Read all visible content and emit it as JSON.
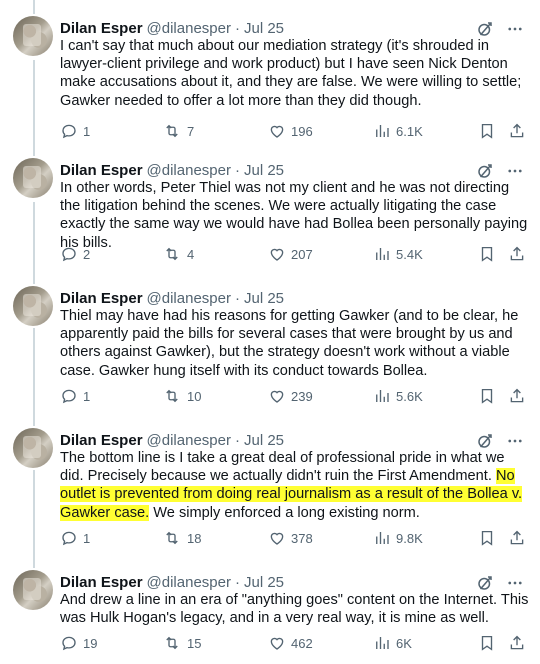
{
  "author": {
    "name": "Dilan Esper",
    "handle": "@dilanesper",
    "separator": "·"
  },
  "colors": {
    "text": "#0f1419",
    "secondary": "#536471",
    "highlight": "#ffff33",
    "thread_line": "#cfd9de"
  },
  "tweets": [
    {
      "date": "Jul 25",
      "text": "I can't say that much about our mediation strategy (it's shrouded in lawyer-client privilege and work product) but I have seen Nick Denton make accusations about it, and they are false. We were willing to settle; Gawker needed to offer a lot more than they did though.",
      "replies": "1",
      "retweets": "7",
      "likes": "196",
      "views": "6.1K"
    },
    {
      "date": "Jul 25",
      "text": "In other words, Peter Thiel was not my client and he was not directing the litigation behind the scenes. We were actually litigating the case exactly the same way we would have had Bollea been personally paying his bills.",
      "replies": "2",
      "retweets": "4",
      "likes": "207",
      "views": "5.4K"
    },
    {
      "date": "Jul 25",
      "text": "Thiel may have had his reasons for getting Gawker (and to be clear, he apparently paid the bills for several cases that were brought by us and others against Gawker), but the strategy doesn't work without a viable case. Gawker hung itself with its conduct towards Bollea.",
      "replies": "1",
      "retweets": "10",
      "likes": "239",
      "views": "5.6K"
    },
    {
      "date": "Jul 25",
      "text_before": "The bottom line is I take a great deal of professional pride in what we did. Precisely because we actually didn't ruin the First Amendment. ",
      "text_highlight": "No outlet is prevented from doing real journalism as a result of the Bollea v. Gawker case.",
      "text_after": " We simply enforced a long existing norm.",
      "replies": "1",
      "retweets": "18",
      "likes": "378",
      "views": "9.8K"
    },
    {
      "date": "Jul 25",
      "text": "And drew a line in an era of \"anything goes\" content on the Internet. This was Hulk Hogan's legacy, and in a very real way, it is mine as well.",
      "replies": "19",
      "retweets": "15",
      "likes": "462",
      "views": "6K"
    }
  ],
  "icons": {
    "header": [
      "grok-icon",
      "more-icon"
    ],
    "actions": [
      "reply-icon",
      "retweet-icon",
      "like-icon",
      "views-icon",
      "bookmark-icon",
      "share-icon"
    ]
  }
}
